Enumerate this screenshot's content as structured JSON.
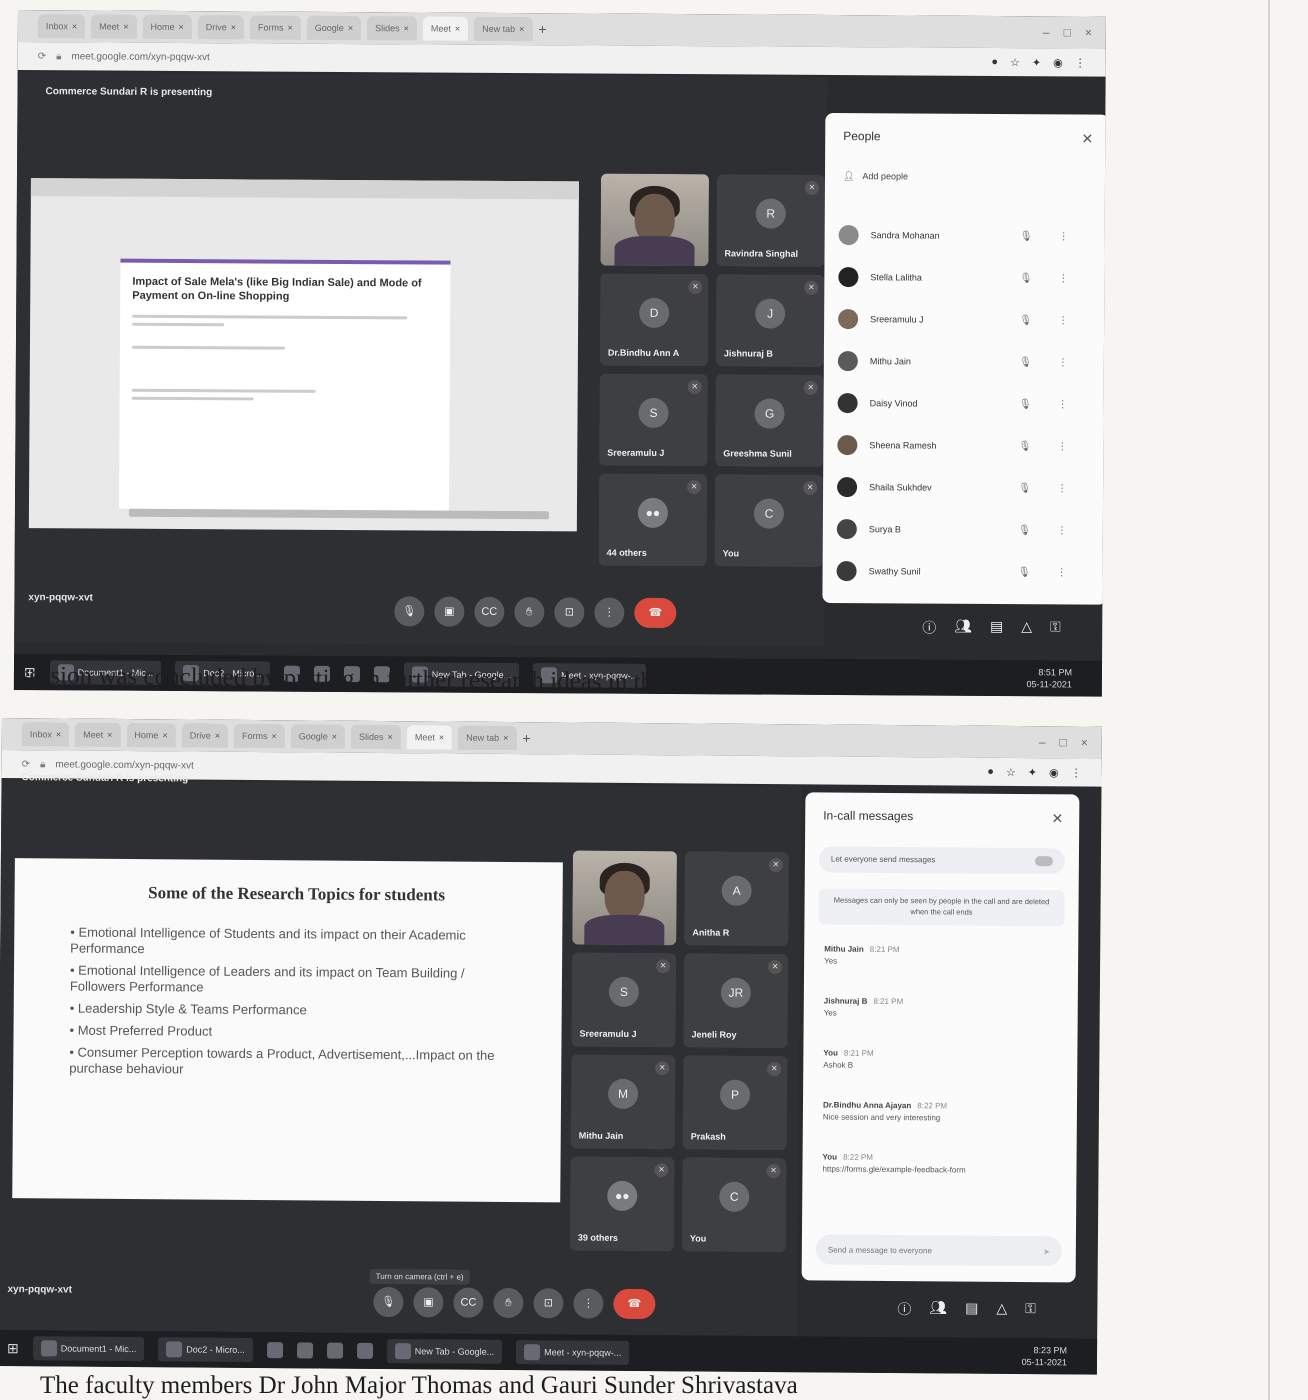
{
  "caption_middle": "session was concluded by putting in further research ideas in the minds of students.",
  "caption_bottom": "The faculty members Dr John Major Thomas and Gauri Sunder Shrivastava",
  "browser": {
    "tabs": [
      "Inbox",
      "Meet",
      "Home",
      "Drive",
      "Forms",
      "Google",
      "Slides",
      "Meet",
      "New tab"
    ],
    "url": "meet.google.com/xyn-pqqw-xvt"
  },
  "shot1": {
    "presenting": "Commerce Sundari R is presenting",
    "doc_title": "Impact of Sale Mela's (like Big Indian Sale) and Mode of Payment on On-line Shopping",
    "tiles": [
      {
        "name": "Presenter",
        "type": "face"
      },
      {
        "name": "Ravindra Singhal",
        "type": "initial",
        "initial": "R"
      },
      {
        "name": "Dr.Bindhu Ann A",
        "type": "initial",
        "initial": "D"
      },
      {
        "name": "Jishnuraj B",
        "type": "initial",
        "initial": "J"
      },
      {
        "name": "Sreeramulu J",
        "type": "initial",
        "initial": "S"
      },
      {
        "name": "Greeshma Sunil",
        "type": "initial",
        "initial": "G"
      },
      {
        "name": "44 others",
        "type": "others"
      },
      {
        "name": "You",
        "type": "initial",
        "initial": "C"
      }
    ],
    "panel_title": "People",
    "add_people": "Add people",
    "people": [
      "Sandra Mohanan",
      "Stella Lalitha",
      "Sreeramulu J",
      "Mithu Jain",
      "Daisy Vinod",
      "Sheena Ramesh",
      "Shaila Sukhdev",
      "Surya B",
      "Swathy Sunil"
    ],
    "meeting_code": "xyn-pqqw-xvt",
    "taskbar_items": [
      "Document1 - Mic...",
      "Doc2 - Micro...",
      "New Tab - Google...",
      "Meet - xyn-pqqw-..."
    ],
    "clock_time": "8:51 PM",
    "clock_date": "05-11-2021"
  },
  "shot2": {
    "presenting": "Commerce Sundari R is presenting",
    "slide_title": "Some of the Research Topics for students",
    "bullets": [
      "Emotional Intelligence of Students and its impact on their Academic Performance",
      "Emotional Intelligence of Leaders and its impact on Team Building / Followers Performance",
      "Leadership Style & Teams Performance",
      "Most Preferred Product",
      "Consumer Perception towards a Product, Advertisement,...Impact on the purchase behaviour"
    ],
    "tiles": [
      {
        "name": "Presenter",
        "type": "face"
      },
      {
        "name": "Anitha R",
        "type": "initial",
        "initial": "A"
      },
      {
        "name": "Sreeramulu J",
        "type": "initial",
        "initial": "S"
      },
      {
        "name": "Jeneli Roy",
        "type": "initial",
        "initial": "JR"
      },
      {
        "name": "Mithu Jain",
        "type": "initial",
        "initial": "M"
      },
      {
        "name": "Prakash",
        "type": "initial",
        "initial": "P"
      },
      {
        "name": "39 others",
        "type": "others"
      },
      {
        "name": "You",
        "type": "initial",
        "initial": "C"
      }
    ],
    "panel_title": "In-call messages",
    "message_toggle": "Let everyone send messages",
    "notice": "Messages can only be seen by people in the call and are deleted when the call ends",
    "messages": [
      {
        "who": "Mithu Jain",
        "time": "8:21 PM",
        "text": "Yes"
      },
      {
        "who": "Jishnuraj B",
        "time": "8:21 PM",
        "text": "Yes"
      },
      {
        "who": "You",
        "time": "8:21 PM",
        "text": "Ashok B"
      },
      {
        "who": "Dr.Bindhu Anna Ajayan",
        "time": "8:22 PM",
        "text": "Nice session and very interesting"
      },
      {
        "who": "You",
        "time": "8:22 PM",
        "text": "https://forms.gle/example-feedback-form"
      }
    ],
    "input_placeholder": "Send a message to everyone",
    "tooltip": "Turn on camera (ctrl + e)",
    "meeting_code": "xyn-pqqw-xvt",
    "taskbar_items": [
      "Document1 - Mic...",
      "Doc2 - Micro...",
      "New Tab - Google...",
      "Meet - xyn-pqqw-..."
    ],
    "clock_time": "8:23 PM",
    "clock_date": "05-11-2021"
  }
}
